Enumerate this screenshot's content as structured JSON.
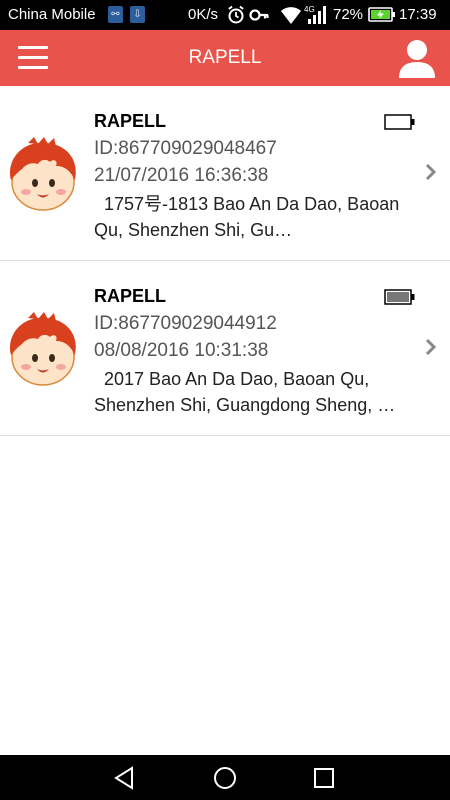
{
  "status_bar": {
    "carrier": "China Mobile",
    "notification_icons": [
      "usb-icon",
      "download-icon"
    ],
    "speed": "0K/s",
    "battery_percent": "72%",
    "time": "17:39",
    "network_label": "4G"
  },
  "app_bar": {
    "title": "RAPELL",
    "menu_icon": "hamburger-menu-icon",
    "profile_icon": "user-profile-icon",
    "background_color": "#e8534b"
  },
  "devices": [
    {
      "name": "RAPELL",
      "id": "ID:867709029048467",
      "timestamp": "21/07/2016 16:36:38",
      "address": "  1757号-1813 Bao An Da Dao, Baoan Qu, Shenzhen Shi, Gu…",
      "battery_level": 0.0
    },
    {
      "name": "RAPELL",
      "id": "ID:867709029044912",
      "timestamp": "08/08/2016 10:31:38",
      "address": "  2017 Bao An Da Dao, Baoan Qu, Shenzhen Shi, Guangdong Sheng, …",
      "battery_level": 1.0
    }
  ],
  "nav_bar": {
    "back_icon": "back-triangle-icon",
    "home_icon": "home-circle-icon",
    "recents_icon": "recents-square-icon"
  }
}
